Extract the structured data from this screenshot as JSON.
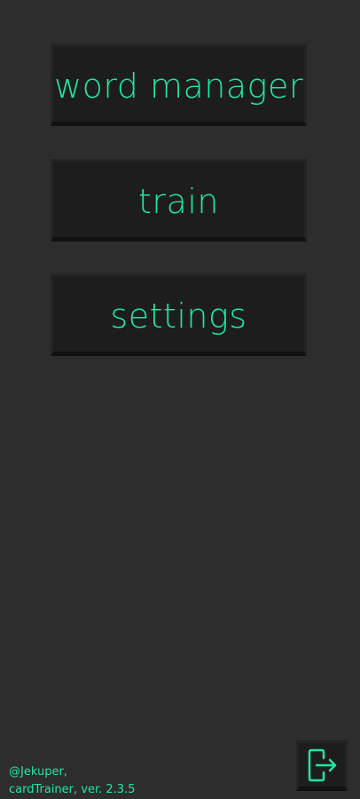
{
  "menu": {
    "word_manager_label": "word manager",
    "train_label": "train",
    "settings_label": "settings"
  },
  "footer": {
    "author": "@Jekuper,",
    "app_version": "cardTrainer, ver. 2.3.5"
  },
  "exit_button": {
    "icon": "logout-icon"
  },
  "colors": {
    "background": "#2d2d2d",
    "button_background": "#1d1d1d",
    "accent": "#1ee8a0"
  }
}
